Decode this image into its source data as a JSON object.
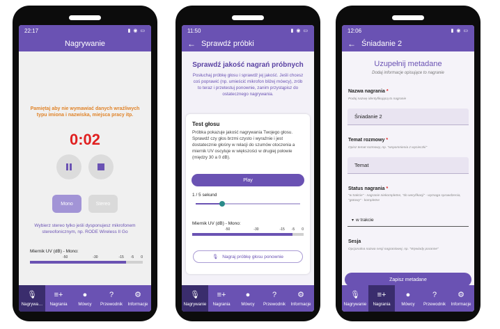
{
  "colors": {
    "primary": "#6a52b3",
    "timer": "#e02020",
    "warning": "#e0842a"
  },
  "bottom_nav": [
    {
      "label": "Nagrywa…",
      "icon": "mic-icon"
    },
    {
      "label": "Nagrania",
      "icon": "playlist-icon"
    },
    {
      "label": "Mówcy",
      "icon": "person-icon"
    },
    {
      "label": "Przewodnik",
      "icon": "help-icon"
    },
    {
      "label": "Informacje",
      "icon": "settings-icon"
    }
  ],
  "bottom_nav_full": [
    {
      "label": "Nagrywanie"
    },
    {
      "label": "Nagrania"
    },
    {
      "label": "Mówcy"
    },
    {
      "label": "Przewodnik"
    },
    {
      "label": "Informacje"
    }
  ],
  "phone1": {
    "status_time": "22:17",
    "title": "Nagrywanie",
    "warning": "Pamiętaj aby nie wymawiać danych wrażliwych typu imiona i nazwiska, miejsca pracy itp.",
    "timer": "0:02",
    "mono_label": "Mono",
    "stereo_label": "Stereo",
    "stereo_hint": "Wybierz stereo tylko jeśli dysponujesz mikrofonem stereofonicznym, np. RODE Wireless II Go",
    "meter_label": "Miernik UV (dB) - Mono:",
    "meter_ticks": [
      "-50",
      "-30",
      "-15",
      "-5",
      "0"
    ],
    "meter_level": 0.85
  },
  "phone2": {
    "status_time": "11:50",
    "title": "Sprawdź próbki",
    "heading": "Sprawdź jakość nagrań próbnych",
    "description": "Posłuchaj próbkę głosu i sprawdź jej jakość. Jeśli chcesz coś poprawić (np. umieścić mikrofon bliżej mówcy), zrób to teraz i przetestuj ponownie, zanim przystąpisz do ostatecznego nagrywania.",
    "card_title": "Test głosu",
    "card_body": "Próbka pokazuje jakość nagrywania Twojego głosu. Sprawdź czy głos brzmi czysto i wyraźnie i jest dostatecznie głośny w relacji do szumów otoczenia a miernik UV oscyluje w większości w drugiej połowie (między 30 a 0 dB).",
    "play_label": "Play",
    "seconds": "1 / 5 sekund",
    "progress": 0.25,
    "meter_label": "Miernik UV (dB) - Mono:",
    "meter_ticks": [
      "-50",
      "-30",
      "-15",
      "-5",
      "0"
    ],
    "meter_level": 0.9,
    "rerecord_label": "Nagraj próbkę głosu ponownie"
  },
  "phone3": {
    "status_time": "12:06",
    "title": "Śniadanie 2",
    "heading": "Uzupełnij metadane",
    "subheading": "Dodaj informacje opisujące to nagranie",
    "fields": {
      "name_label": "Nazwa nagrania",
      "name_help": "Podaj nazwę identyfikującą to nagranie",
      "name_value": "Śniadanie 2",
      "topic_label": "Temat rozmowy",
      "topic_help": "Opisz temat rozmowy, np. \"wspomnienia z wycieczki\"",
      "topic_value": "Temat",
      "status_label": "Status nagrania",
      "status_help": "\"w trakcie\" - nagranie niekompletne, \"do weryfikacji\" - wymaga sprawdzenia, \"gotowy\" - kompletne",
      "status_value": "w trakcie",
      "session_label": "Sesja",
      "session_help": "Opcjonalna nazwa sesji nagraniowej, np. \"Wywiady poranne\""
    },
    "required_marker": "*",
    "save_label": "Zapisz metadane"
  }
}
